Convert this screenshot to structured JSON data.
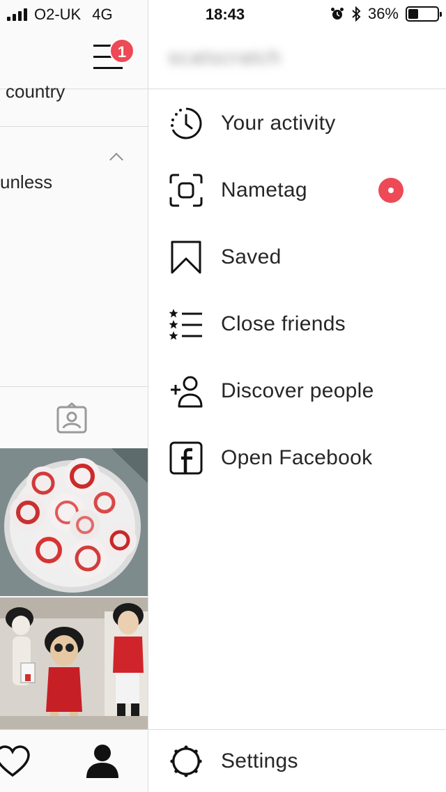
{
  "status_bar": {
    "carrier": "O2-UK",
    "network": "4G",
    "time": "18:43",
    "battery_percent": "36%",
    "battery_level": 0.36
  },
  "profile_panel": {
    "notification_count": "1",
    "text_line_1": "country",
    "text_line_2": "unless"
  },
  "drawer": {
    "username": "scatscratch",
    "menu": [
      {
        "label": "Your activity",
        "icon": "activity-icon"
      },
      {
        "label": "Nametag",
        "icon": "nametag-icon"
      },
      {
        "label": "Saved",
        "icon": "bookmark-icon"
      },
      {
        "label": "Close friends",
        "icon": "close-friends-icon"
      },
      {
        "label": "Discover people",
        "icon": "add-person-icon"
      },
      {
        "label": "Open Facebook",
        "icon": "facebook-icon"
      }
    ],
    "settings_label": "Settings"
  },
  "colors": {
    "badge": "#ed4956",
    "divider": "#dbdbdb",
    "text": "#262626"
  }
}
